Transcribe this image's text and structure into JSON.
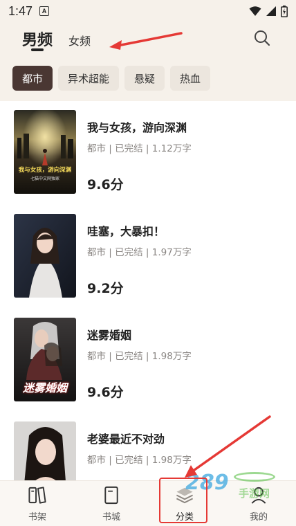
{
  "status_bar": {
    "time": "1:47",
    "notif_icon": "A"
  },
  "header": {
    "tabs": [
      {
        "label": "男频",
        "active": true
      },
      {
        "label": "女频",
        "active": false
      }
    ]
  },
  "categories": [
    {
      "label": "都市",
      "active": true
    },
    {
      "label": "异术超能",
      "active": false
    },
    {
      "label": "悬疑",
      "active": false
    },
    {
      "label": "热血",
      "active": false
    }
  ],
  "books": [
    {
      "title": "我与女孩，游向深渊",
      "meta": "都市 | 已完结 | 1.12万字",
      "score": "9.6分",
      "cover_text": "我与女孩，游向深渊",
      "cover_sub": "七猫中文网独家"
    },
    {
      "title": "哇塞，大暴扣！",
      "meta": "都市 | 已完结 | 1.97万字",
      "score": "9.2分"
    },
    {
      "title": "迷雾婚姻",
      "meta": "都市 | 已完结 | 1.98万字",
      "score": "9.6分",
      "cover_text": "迷雾婚姻"
    },
    {
      "title": "老婆最近不对劲",
      "meta": "都市 | 已完结 | 1.98万字",
      "score": ""
    }
  ],
  "bottom_nav": [
    {
      "label": "书架",
      "icon": "bookshelf-icon"
    },
    {
      "label": "书城",
      "icon": "book-icon"
    },
    {
      "label": "分类",
      "icon": "category-stack-icon",
      "active": true
    },
    {
      "label": "我的",
      "icon": "profile-icon"
    }
  ],
  "watermark": {
    "text": "289",
    "text2": "手游网"
  },
  "colors": {
    "accent": "#4a3733",
    "background": "#f6f1ea",
    "annotation_red": "#e53935"
  }
}
